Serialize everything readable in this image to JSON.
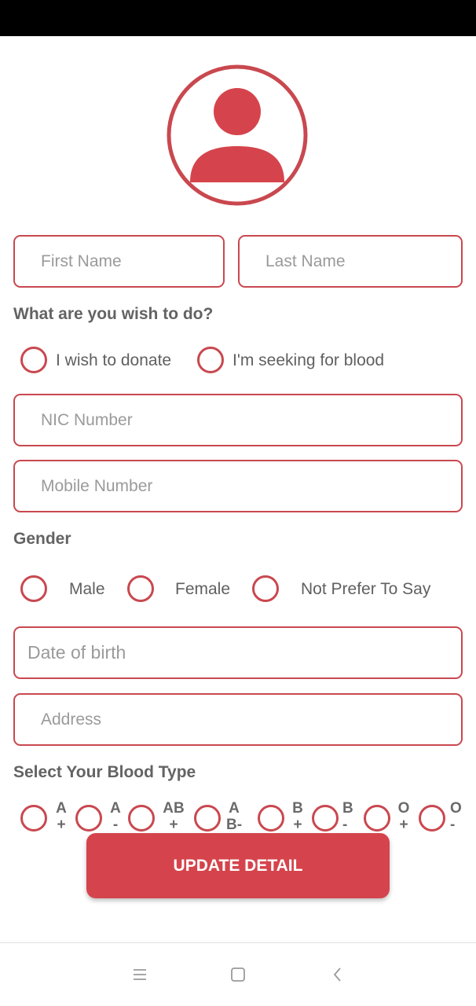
{
  "form": {
    "first_name_placeholder": "First Name",
    "last_name_placeholder": "Last Name",
    "wish_question": "What are you wish to do?",
    "wish_options": [
      "I wish to donate",
      "I'm seeking for blood"
    ],
    "nic_placeholder": "NIC Number",
    "mobile_placeholder": "Mobile Number",
    "gender_label": "Gender",
    "gender_options": [
      "Male",
      "Female",
      "Not Prefer To Say"
    ],
    "dob_placeholder": "Date of birth",
    "address_placeholder": "Address",
    "blood_type_label": "Select Your Blood Type",
    "blood_types": [
      {
        "letter": "A",
        "sign": "+"
      },
      {
        "letter": "A",
        "sign": "-"
      },
      {
        "letter": "AB",
        "sign": "+"
      },
      {
        "letter": "A",
        "sign": "B-"
      },
      {
        "letter": "B",
        "sign": "+"
      },
      {
        "letter": "B",
        "sign": "-"
      },
      {
        "letter": "O",
        "sign": "+"
      },
      {
        "letter": "O",
        "sign": "-"
      }
    ],
    "update_button": "UPDATE DETAIL"
  },
  "colors": {
    "accent": "#d5444c",
    "border": "#c9484f",
    "label": "#636363"
  },
  "icons": {
    "avatar": "user-avatar-icon",
    "nav_menu": "menu-icon",
    "nav_home": "square-home-icon",
    "nav_back": "chevron-left-icon"
  }
}
